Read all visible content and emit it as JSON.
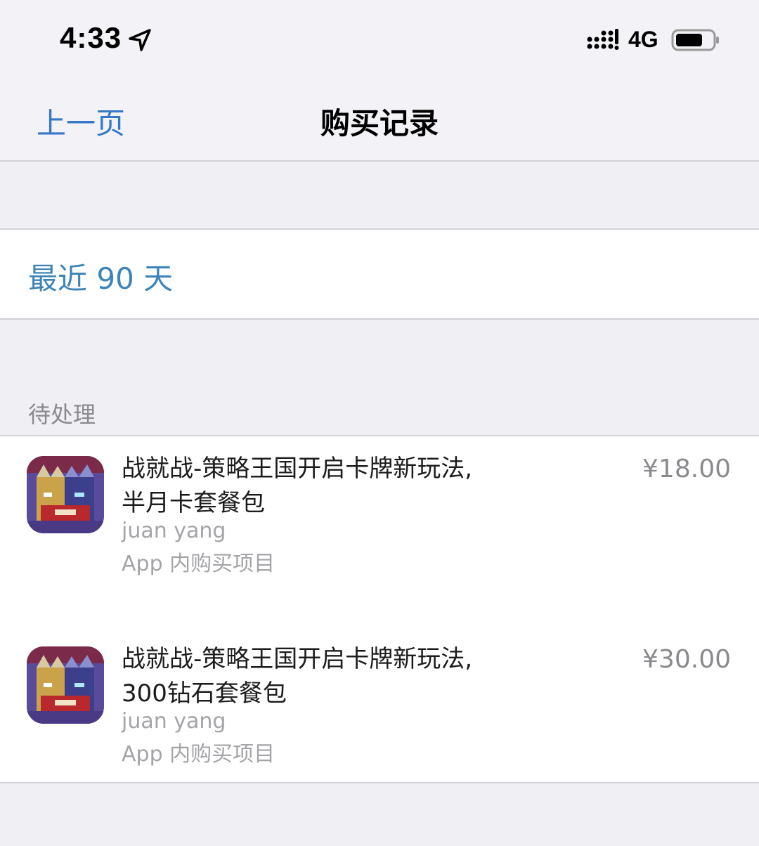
{
  "status_bar": {
    "time": "4:33",
    "network": "4G",
    "icons": [
      "location-arrow-icon",
      "signal-bars-icon",
      "battery-icon"
    ]
  },
  "nav": {
    "back_label": "上一页",
    "title": "购买记录"
  },
  "period": {
    "label": "最近 90 天"
  },
  "section": {
    "header": "待处理"
  },
  "purchases": [
    {
      "title": "战就战-策略王国开启卡牌新玩法, 半月卡套餐包",
      "owner": "juan yang",
      "type": "App 内购买项目",
      "price": "¥18.00",
      "icon": "game-app-icon"
    },
    {
      "title": "战就战-策略王国开启卡牌新玩法, 300钻石套餐包",
      "owner": "juan yang",
      "type": "App 内购买项目",
      "price": "¥30.00",
      "icon": "game-app-icon"
    }
  ],
  "colors": {
    "link_blue": "#3478c7",
    "period_blue": "#3d84b8",
    "secondary_gray": "#8a8a8e",
    "background": "#efeff4"
  }
}
